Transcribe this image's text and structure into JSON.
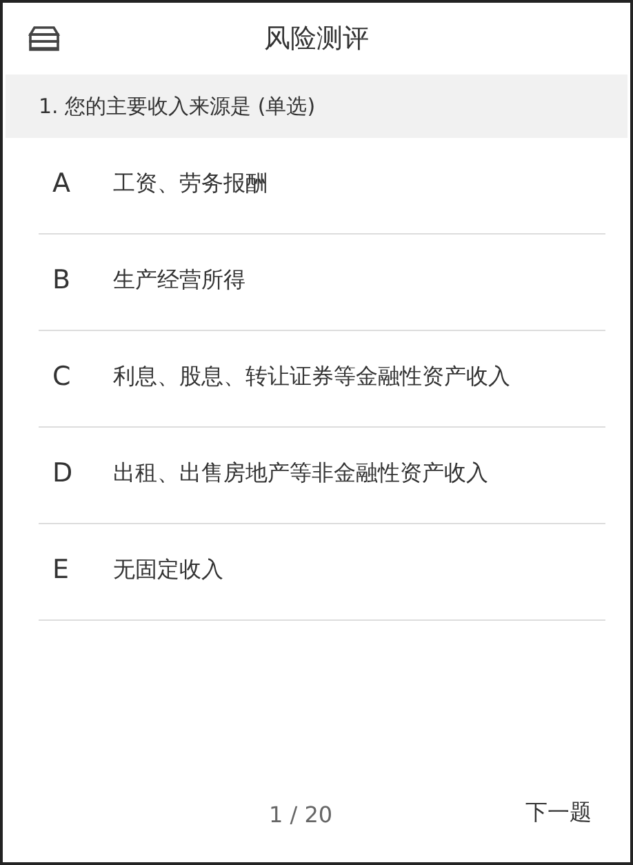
{
  "header": {
    "title": "风险测评"
  },
  "question": {
    "text": "1. 您的主要收入来源是 (单选)"
  },
  "options": [
    {
      "letter": "A",
      "text": "工资、劳务报酬",
      "selected": false
    },
    {
      "letter": "B",
      "text": "生产经营所得",
      "selected": false
    },
    {
      "letter": "C",
      "text": "利息、股息、转让证券等金融性资产收入",
      "selected": false
    },
    {
      "letter": "D",
      "text": "出租、出售房地产等非金融性资产收入",
      "selected": false
    },
    {
      "letter": "E",
      "text": "无固定收入",
      "selected": false
    }
  ],
  "footer": {
    "progress": "1 / 20",
    "next": "下一题"
  }
}
